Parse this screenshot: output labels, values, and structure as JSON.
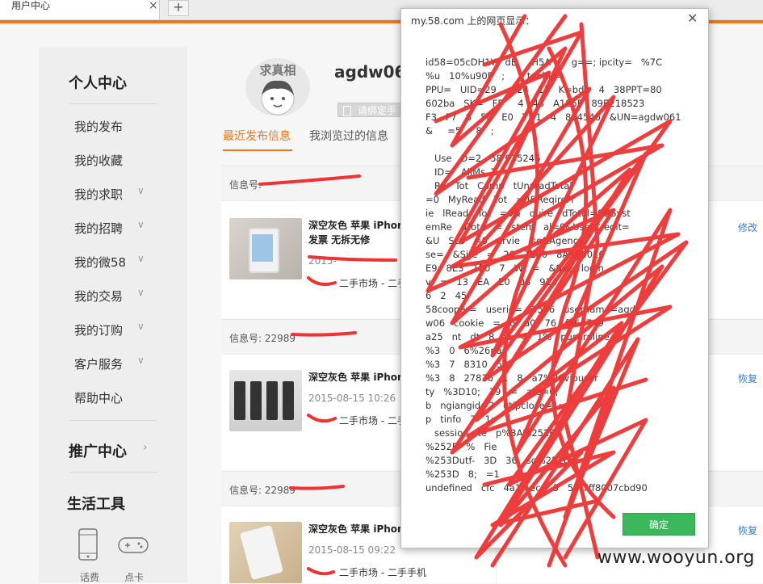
{
  "browser": {
    "tab_title": "用户中心",
    "close_glyph": "×",
    "new_tab_glyph": "+"
  },
  "sidebar": {
    "personal_center": "个人中心",
    "items": [
      {
        "label": "我的发布",
        "chevron": false
      },
      {
        "label": "我的收藏",
        "chevron": false
      },
      {
        "label": "我的求职",
        "chevron": true
      },
      {
        "label": "我的招聘",
        "chevron": true
      },
      {
        "label": "我的微58",
        "chevron": true
      },
      {
        "label": "我的交易",
        "chevron": true
      },
      {
        "label": "我的订购",
        "chevron": true
      },
      {
        "label": "客户服务",
        "chevron": true
      },
      {
        "label": "帮助中心",
        "chevron": false
      }
    ],
    "promo_center": "推广中心",
    "life_tools": "生活工具",
    "tools": [
      {
        "label": "话费",
        "icon": "mobile-phone-icon"
      },
      {
        "label": "点卡",
        "icon": "gamepad-icon"
      }
    ]
  },
  "profile": {
    "avatar_text": "求真相",
    "username": "agdw06",
    "bind_phone": "请绑定手"
  },
  "tabs": {
    "recent": "最近发布信息",
    "browsed": "我浏览过的信息"
  },
  "listings": [
    {
      "info_no": "信息号:",
      "title_line1": "深空灰色 苹果 iPhon",
      "title_line2": "发票 无拆无修",
      "date": "2015-",
      "category": "二手市场 - 二手",
      "action": "修改"
    },
    {
      "info_no": "信息号: 22989",
      "title_line1": "深空灰色 苹果 iPhon",
      "title_line2": "",
      "date": "2015-08-15 10:26",
      "category": "二手市场 - 二手",
      "action": "恢复"
    },
    {
      "info_no": "信息号: 22989",
      "title_line1": "深空灰色 苹果 iPhon",
      "title_line2": "",
      "date": "2015-08-15 09:22",
      "category": "二手市场 - 二手手机",
      "action": "恢复"
    }
  ],
  "dialog": {
    "title": "my.58.com 上的网页显示：",
    "close_glyph": "✕",
    "message": "id58=05cDH1Y   dE     H5A       g==; ipcity=   %7C\n%u   10%u90F   ;      _tooltip=   \nPPU=   UID=29       24   17   K=bdb   4   38PPT=80\n602ba   SK=   FF     4   43   A185F   89E218523\nF3   F7   8   5B   E0   T=1   4   834546   &UN=agdw061\n&     =5     8   ;\n   \n   Use   D=2   58 035246\n   ID=   AllMs  T\n   Re   Tot   Comp   tUnreadTotal\n=0   MyRead   Tot   =0&ReqireFr\nie   lRead   Tot   =0&   quire   dTotal=0&Syst\nemRe   dTota   =   stem   al=0&UserCredit=\n&U   Sco   =0   urvie   lse&Agency\nse=   &Site   =   20   7E00   8A9B0016\nE9   8E3   1E0   7   W   =   &Sse   login\nv   =   13   EA   E0   08   914\n6   2   45\n58cooper=   userid=   3546   username=agd\nw06   cookie   =   6   a0   76   fa6d749\na25   nt   dt   8   vi   =   1%   puserpline\n%3   0   6%26nas\n%3   7   8310   52\n%3   8   27836   1   8   a7%26vipuser\nty   %3D10;   29   =   ate=0;\nb   ngiangid=2   otipclose=1;\np   tinfo   7   1;\n   session   te   p%3A%252F\n%252F   %   Fie\n%253Dutf-   3D   36   so%2526q\n%253D   8;   =1\nundefined   cfc   4a1   ec-   3   59-7ff8007cbd90",
    "ok_label": "确定"
  },
  "watermark": "www.wooyun.org",
  "colors": {
    "accent_orange": "#f0761c",
    "link_blue": "#3a7ad0",
    "ok_green": "#3cb85c",
    "scribble_red": "#ee3333"
  }
}
